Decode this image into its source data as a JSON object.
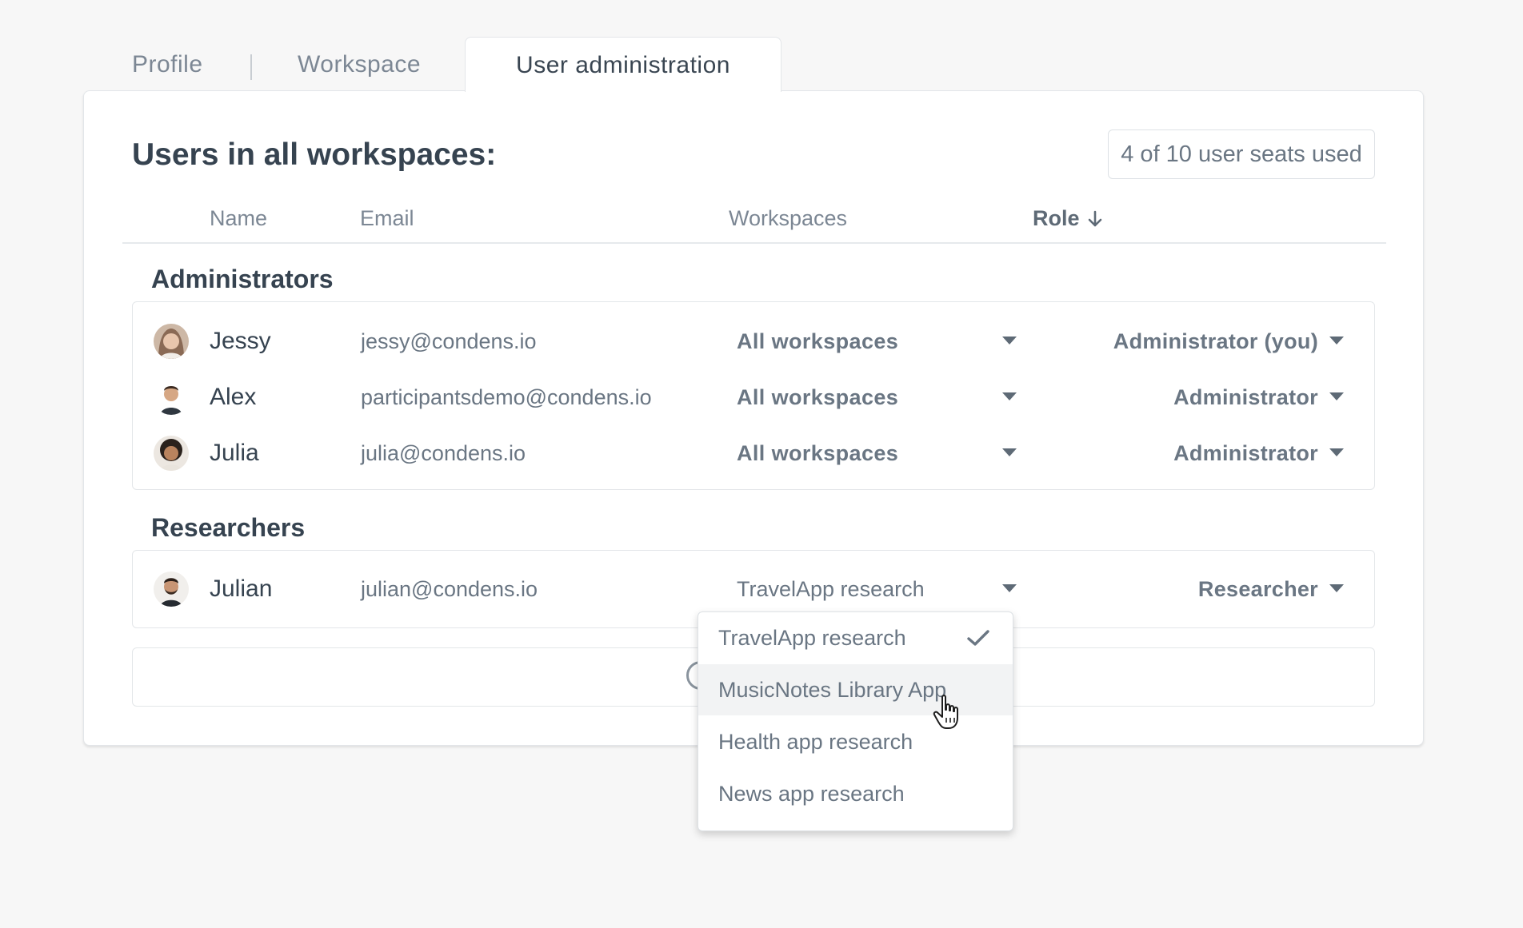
{
  "tabs": [
    {
      "label": "Profile"
    },
    {
      "label": "Workspace"
    },
    {
      "label": "User administration"
    }
  ],
  "panel": {
    "title": "Users in all workspaces:",
    "seats_badge": "4 of 10 user seats used",
    "columns": {
      "name": "Name",
      "email": "Email",
      "workspaces": "Workspaces",
      "role": "Role"
    }
  },
  "groups": [
    {
      "title": "Administrators",
      "users": [
        {
          "name": "Jessy",
          "email": "jessy@condens.io",
          "workspaces": "All workspaces",
          "role": "Administrator (you)"
        },
        {
          "name": "Alex",
          "email": "participantsdemo@condens.io",
          "workspaces": "All workspaces",
          "role": "Administrator"
        },
        {
          "name": "Julia",
          "email": "julia@condens.io",
          "workspaces": "All workspaces",
          "role": "Administrator"
        }
      ]
    },
    {
      "title": "Researchers",
      "users": [
        {
          "name": "Julian",
          "email": "julian@condens.io",
          "workspaces": "TravelApp research",
          "role": "Researcher"
        }
      ]
    }
  ],
  "workspace_dropdown": {
    "options": [
      {
        "label": "TravelApp research",
        "selected": true
      },
      {
        "label": "MusicNotes Library App",
        "hovered": true
      },
      {
        "label": "Health app research"
      },
      {
        "label": "News app research"
      }
    ]
  },
  "icons": {
    "sort": "arrow-down-icon",
    "caret": "caret-down-icon",
    "check": "check-icon",
    "add": "add-circle-icon",
    "cursor": "hand-pointer-cursor-icon"
  },
  "colors": {
    "background": "#f7f7f7",
    "panel": "#ffffff",
    "heading": "#364350",
    "muted_text": "#6a7683",
    "border": "#e3e6e9",
    "hover": "#f2f3f4"
  }
}
